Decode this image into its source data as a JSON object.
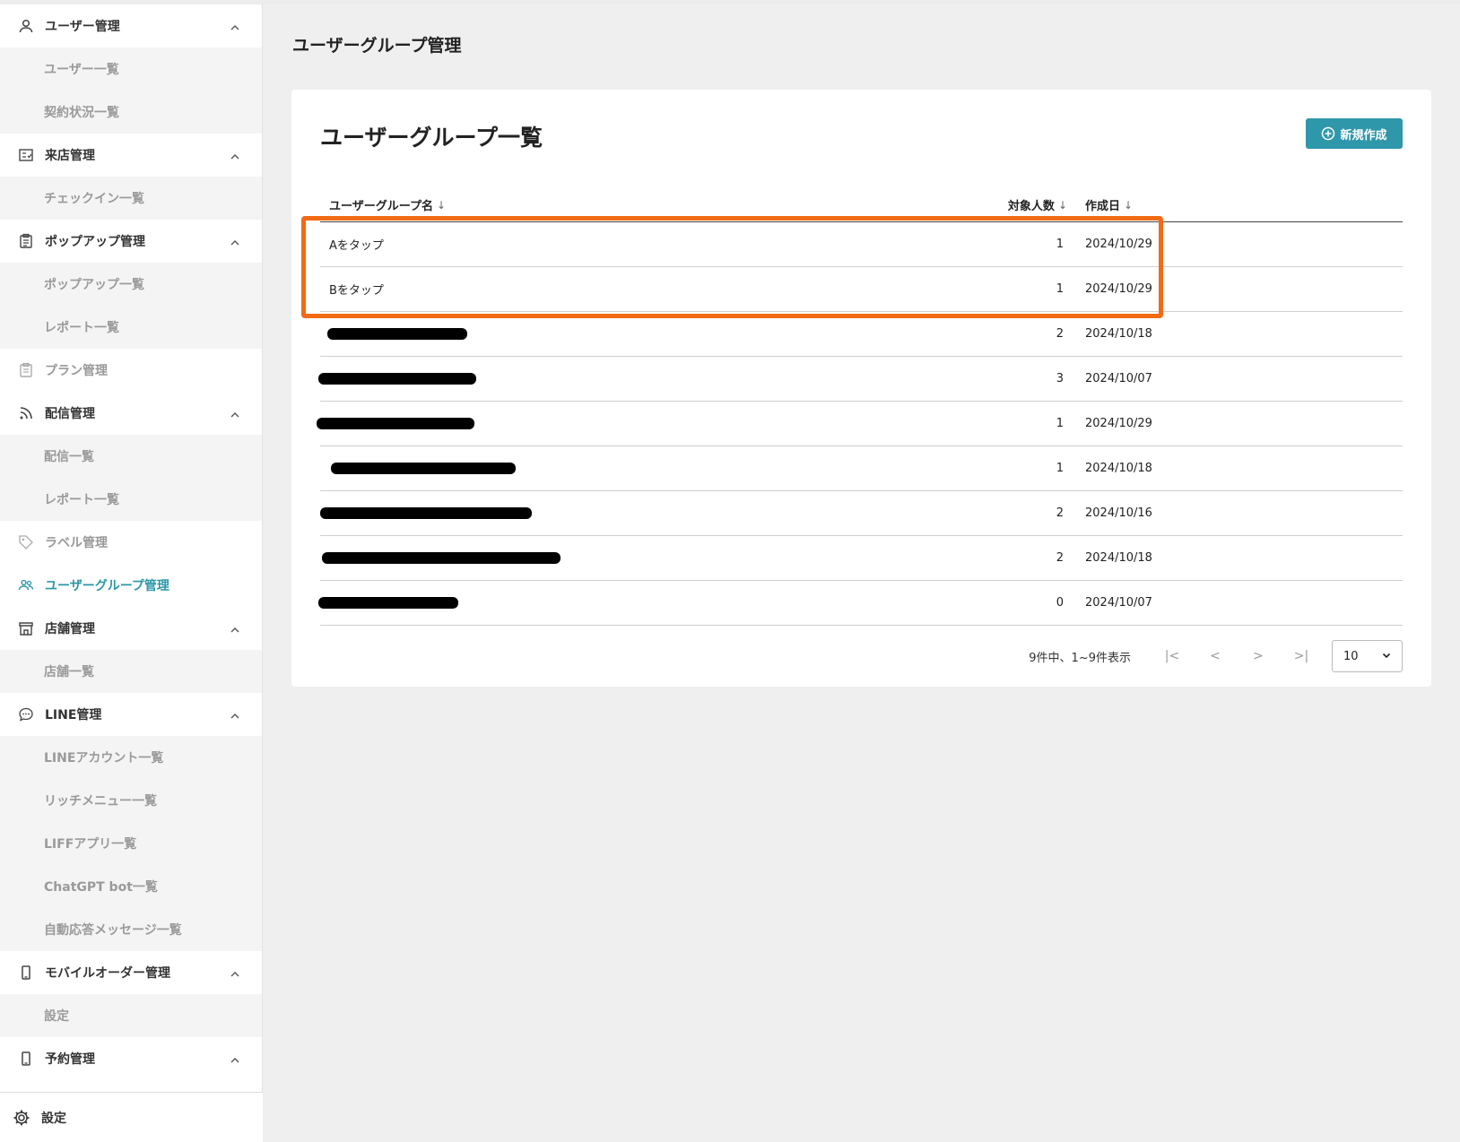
{
  "sidebar": {
    "sections": [
      {
        "label": "ユーザー管理",
        "icon": "user-icon",
        "state": "normal",
        "expanded": true,
        "items": [
          "ユーザー一覧",
          "契約状況一覧"
        ]
      },
      {
        "label": "来店管理",
        "icon": "checkin-icon",
        "state": "normal",
        "expanded": true,
        "items": [
          "チェックイン一覧"
        ]
      },
      {
        "label": "ポップアップ管理",
        "icon": "clipboard-icon",
        "state": "normal",
        "expanded": true,
        "items": [
          "ポップアップ一覧",
          "レポート一覧"
        ]
      },
      {
        "label": "プラン管理",
        "icon": "document-icon",
        "state": "dim",
        "expanded": false,
        "items": []
      },
      {
        "label": "配信管理",
        "icon": "rss-icon",
        "state": "normal",
        "expanded": true,
        "items": [
          "配信一覧",
          "レポート一覧"
        ]
      },
      {
        "label": "ラベル管理",
        "icon": "tag-icon",
        "state": "dim",
        "expanded": false,
        "items": []
      },
      {
        "label": "ユーザーグループ管理",
        "icon": "users-group-icon",
        "state": "active",
        "expanded": false,
        "items": []
      },
      {
        "label": "店舗管理",
        "icon": "store-icon",
        "state": "normal",
        "expanded": true,
        "items": [
          "店舗一覧"
        ]
      },
      {
        "label": "LINE管理",
        "icon": "chat-bubble-icon",
        "state": "normal",
        "expanded": true,
        "items": [
          "LINEアカウント一覧",
          "リッチメニュー一覧",
          "LIFFアプリ一覧",
          "ChatGPT bot一覧",
          "自動応答メッセージ一覧"
        ]
      },
      {
        "label": "モバイルオーダー管理",
        "icon": "mobile-icon",
        "state": "normal",
        "expanded": true,
        "items": [
          "設定"
        ]
      },
      {
        "label": "予約管理",
        "icon": "mobile-icon",
        "state": "normal",
        "expanded": true,
        "items": []
      }
    ],
    "settings_label": "設定"
  },
  "page": {
    "title": "ユーザーグループ管理",
    "card_title": "ユーザーグループ一覧",
    "new_button_label": "新規作成"
  },
  "table": {
    "columns": {
      "name": "ユーザーグループ名",
      "count": "対象人数",
      "date": "作成日"
    },
    "rows": [
      {
        "name": "Aをタップ",
        "count": "1",
        "date": "2024/10/29",
        "redacted": false
      },
      {
        "name": "Bをタップ",
        "count": "1",
        "date": "2024/10/29",
        "redacted": false
      },
      {
        "name": "",
        "count": "2",
        "date": "2024/10/18",
        "redacted": true
      },
      {
        "name": "",
        "count": "3",
        "date": "2024/10/07",
        "redacted": true
      },
      {
        "name": "",
        "count": "1",
        "date": "2024/10/29",
        "redacted": true
      },
      {
        "name": "",
        "count": "1",
        "date": "2024/10/18",
        "redacted": true
      },
      {
        "name": "",
        "count": "2",
        "date": "2024/10/16",
        "redacted": true
      },
      {
        "name": "",
        "count": "2",
        "date": "2024/10/18",
        "redacted": true
      },
      {
        "name": "",
        "count": "0",
        "date": "2024/10/07",
        "redacted": true
      }
    ]
  },
  "pagination": {
    "info": "9件中、1~9件表示",
    "page_size": "10"
  },
  "colors": {
    "accent": "#2f97aa",
    "highlight": "#f26a14"
  }
}
